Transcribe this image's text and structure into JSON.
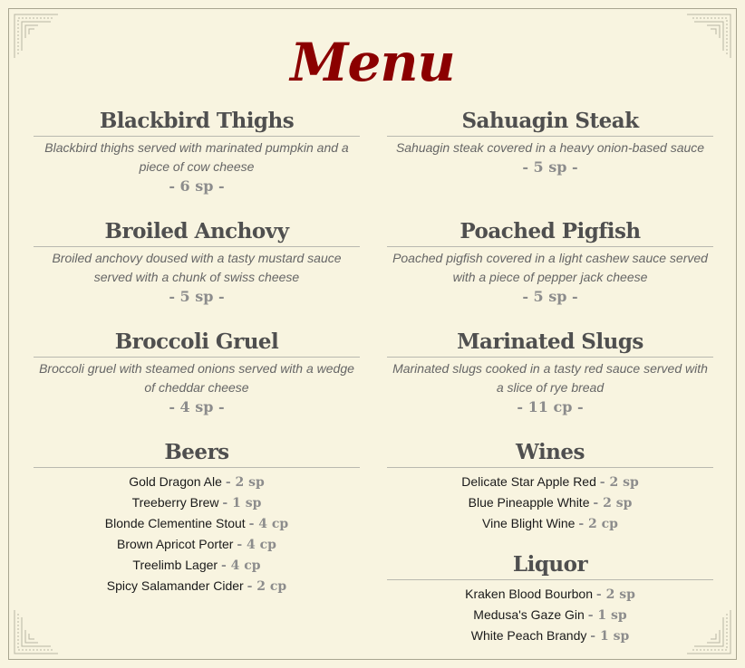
{
  "title": "Menu",
  "colors": {
    "title": "#8b0000",
    "heading": "#4f4f4f",
    "price": "#8c8c8c",
    "background": "#f8f4e0"
  },
  "left_dishes": [
    {
      "name": "Blackbird Thighs",
      "desc": "Blackbird thighs served with marinated pumpkin and a piece of cow cheese",
      "price": "- 6 sp -"
    },
    {
      "name": "Broiled Anchovy",
      "desc": "Broiled anchovy doused with a tasty mustard sauce served with a chunk of swiss cheese",
      "price": "- 5 sp -"
    },
    {
      "name": "Broccoli Gruel",
      "desc": "Broccoli gruel with steamed onions served with a wedge of cheddar cheese",
      "price": "- 4 sp -"
    }
  ],
  "right_dishes": [
    {
      "name": "Sahuagin Steak",
      "desc": "Sahuagin steak covered in a heavy onion-based sauce",
      "price": "- 5 sp -"
    },
    {
      "name": "Poached Pigfish",
      "desc": "Poached pigfish covered in a light cashew sauce served with a piece of pepper jack cheese",
      "price": "- 5 sp -"
    },
    {
      "name": "Marinated Slugs",
      "desc": "Marinated slugs cooked in a tasty red sauce served with a slice of rye bread",
      "price": "- 11 cp -"
    }
  ],
  "beers": {
    "heading": "Beers",
    "items": [
      {
        "name": "Gold Dragon Ale",
        "price": "- 2 sp"
      },
      {
        "name": "Treeberry Brew",
        "price": "- 1 sp"
      },
      {
        "name": "Blonde Clementine Stout",
        "price": "- 4 cp"
      },
      {
        "name": "Brown Apricot Porter",
        "price": "- 4 cp"
      },
      {
        "name": "Treelimb Lager",
        "price": "- 4 cp"
      },
      {
        "name": "Spicy Salamander Cider",
        "price": "- 2 cp"
      }
    ]
  },
  "wines": {
    "heading": "Wines",
    "items": [
      {
        "name": "Delicate Star Apple Red",
        "price": "- 2 sp"
      },
      {
        "name": "Blue Pineapple White",
        "price": "- 2 sp"
      },
      {
        "name": "Vine Blight Wine",
        "price": "- 2 cp"
      }
    ]
  },
  "liquor": {
    "heading": "Liquor",
    "items": [
      {
        "name": "Kraken Blood Bourbon",
        "price": "- 2 sp"
      },
      {
        "name": "Medusa's Gaze Gin",
        "price": "- 1 sp"
      },
      {
        "name": "White Peach Brandy",
        "price": "- 1 sp"
      }
    ]
  }
}
